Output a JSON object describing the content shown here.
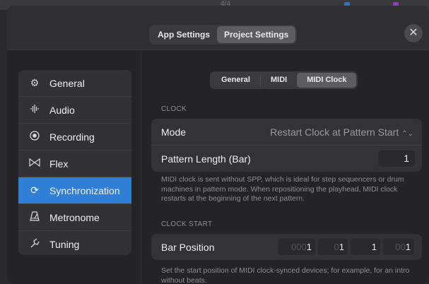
{
  "background_toolbar": {
    "time_signature": "4/4"
  },
  "header": {
    "tabs": [
      {
        "label": "App Settings",
        "active": false
      },
      {
        "label": "Project Settings",
        "active": true
      }
    ],
    "close_icon": "close-icon"
  },
  "sidebar": {
    "items": [
      {
        "label": "General",
        "icon": "gear-icon",
        "active": false
      },
      {
        "label": "Audio",
        "icon": "waveform-icon",
        "active": false
      },
      {
        "label": "Recording",
        "icon": "record-icon",
        "active": false
      },
      {
        "label": "Flex",
        "icon": "flex-icon",
        "active": false
      },
      {
        "label": "Synchronization",
        "icon": "sync-icon",
        "active": true
      },
      {
        "label": "Metronome",
        "icon": "metronome-icon",
        "active": false
      },
      {
        "label": "Tuning",
        "icon": "tuning-fork-icon",
        "active": false
      }
    ]
  },
  "subtabs": [
    {
      "label": "General",
      "active": false
    },
    {
      "label": "MIDI",
      "active": false
    },
    {
      "label": "MIDI Clock",
      "active": true
    }
  ],
  "clock": {
    "section_label": "CLOCK",
    "mode_label": "Mode",
    "mode_value": "Restart Clock at Pattern Start",
    "pattern_length_label": "Pattern Length (Bar)",
    "pattern_length_value": "1",
    "description": "MIDI clock is sent without SPP, which is ideal for step sequencers or drum machines in pattern mode. When repositioning the playhead, MIDI clock restarts at the beginning of the next pattern."
  },
  "clock_start": {
    "section_label": "CLOCK START",
    "bar_position_label": "Bar Position",
    "bar_position_fields": [
      {
        "dim": "000",
        "val": "1"
      },
      {
        "dim": "0",
        "val": "1"
      },
      {
        "dim": "",
        "val": "1"
      },
      {
        "dim": "00",
        "val": "1"
      }
    ],
    "description": "Set the start position of MIDI clock-synced devices; for example, for an intro without beats."
  },
  "colors": {
    "accent": "#2f7fd7",
    "panel": "#333336",
    "background": "#242426"
  }
}
